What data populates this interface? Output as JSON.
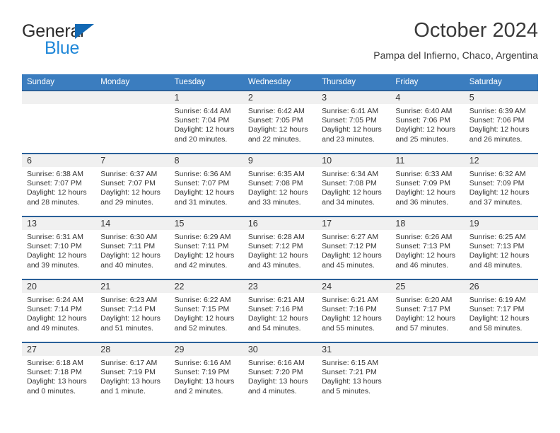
{
  "brand": {
    "line1": "General",
    "line2": "Blue",
    "triangle_color": "#1268b3",
    "blue_text_color": "#1f87d8"
  },
  "header": {
    "title": "October 2024",
    "subtitle": "Pampa del Infierno, Chaco, Argentina"
  },
  "theme": {
    "header_bg": "#3b7dbf",
    "row_border": "#2a6099",
    "daynum_bg": "#f0f0f0"
  },
  "weekday_headers": [
    "Sunday",
    "Monday",
    "Tuesday",
    "Wednesday",
    "Thursday",
    "Friday",
    "Saturday"
  ],
  "labels": {
    "sunrise_prefix": "Sunrise:",
    "sunset_prefix": "Sunset:",
    "daylight_prefix": "Daylight:"
  },
  "weeks": [
    [
      {
        "day": "",
        "sunrise": "",
        "sunset": "",
        "daylight_line1": "",
        "daylight_line2": ""
      },
      {
        "day": "",
        "sunrise": "",
        "sunset": "",
        "daylight_line1": "",
        "daylight_line2": ""
      },
      {
        "day": "1",
        "sunrise": "Sunrise: 6:44 AM",
        "sunset": "Sunset: 7:04 PM",
        "daylight_line1": "Daylight: 12 hours",
        "daylight_line2": "and 20 minutes."
      },
      {
        "day": "2",
        "sunrise": "Sunrise: 6:42 AM",
        "sunset": "Sunset: 7:05 PM",
        "daylight_line1": "Daylight: 12 hours",
        "daylight_line2": "and 22 minutes."
      },
      {
        "day": "3",
        "sunrise": "Sunrise: 6:41 AM",
        "sunset": "Sunset: 7:05 PM",
        "daylight_line1": "Daylight: 12 hours",
        "daylight_line2": "and 23 minutes."
      },
      {
        "day": "4",
        "sunrise": "Sunrise: 6:40 AM",
        "sunset": "Sunset: 7:06 PM",
        "daylight_line1": "Daylight: 12 hours",
        "daylight_line2": "and 25 minutes."
      },
      {
        "day": "5",
        "sunrise": "Sunrise: 6:39 AM",
        "sunset": "Sunset: 7:06 PM",
        "daylight_line1": "Daylight: 12 hours",
        "daylight_line2": "and 26 minutes."
      }
    ],
    [
      {
        "day": "6",
        "sunrise": "Sunrise: 6:38 AM",
        "sunset": "Sunset: 7:07 PM",
        "daylight_line1": "Daylight: 12 hours",
        "daylight_line2": "and 28 minutes."
      },
      {
        "day": "7",
        "sunrise": "Sunrise: 6:37 AM",
        "sunset": "Sunset: 7:07 PM",
        "daylight_line1": "Daylight: 12 hours",
        "daylight_line2": "and 29 minutes."
      },
      {
        "day": "8",
        "sunrise": "Sunrise: 6:36 AM",
        "sunset": "Sunset: 7:07 PM",
        "daylight_line1": "Daylight: 12 hours",
        "daylight_line2": "and 31 minutes."
      },
      {
        "day": "9",
        "sunrise": "Sunrise: 6:35 AM",
        "sunset": "Sunset: 7:08 PM",
        "daylight_line1": "Daylight: 12 hours",
        "daylight_line2": "and 33 minutes."
      },
      {
        "day": "10",
        "sunrise": "Sunrise: 6:34 AM",
        "sunset": "Sunset: 7:08 PM",
        "daylight_line1": "Daylight: 12 hours",
        "daylight_line2": "and 34 minutes."
      },
      {
        "day": "11",
        "sunrise": "Sunrise: 6:33 AM",
        "sunset": "Sunset: 7:09 PM",
        "daylight_line1": "Daylight: 12 hours",
        "daylight_line2": "and 36 minutes."
      },
      {
        "day": "12",
        "sunrise": "Sunrise: 6:32 AM",
        "sunset": "Sunset: 7:09 PM",
        "daylight_line1": "Daylight: 12 hours",
        "daylight_line2": "and 37 minutes."
      }
    ],
    [
      {
        "day": "13",
        "sunrise": "Sunrise: 6:31 AM",
        "sunset": "Sunset: 7:10 PM",
        "daylight_line1": "Daylight: 12 hours",
        "daylight_line2": "and 39 minutes."
      },
      {
        "day": "14",
        "sunrise": "Sunrise: 6:30 AM",
        "sunset": "Sunset: 7:11 PM",
        "daylight_line1": "Daylight: 12 hours",
        "daylight_line2": "and 40 minutes."
      },
      {
        "day": "15",
        "sunrise": "Sunrise: 6:29 AM",
        "sunset": "Sunset: 7:11 PM",
        "daylight_line1": "Daylight: 12 hours",
        "daylight_line2": "and 42 minutes."
      },
      {
        "day": "16",
        "sunrise": "Sunrise: 6:28 AM",
        "sunset": "Sunset: 7:12 PM",
        "daylight_line1": "Daylight: 12 hours",
        "daylight_line2": "and 43 minutes."
      },
      {
        "day": "17",
        "sunrise": "Sunrise: 6:27 AM",
        "sunset": "Sunset: 7:12 PM",
        "daylight_line1": "Daylight: 12 hours",
        "daylight_line2": "and 45 minutes."
      },
      {
        "day": "18",
        "sunrise": "Sunrise: 6:26 AM",
        "sunset": "Sunset: 7:13 PM",
        "daylight_line1": "Daylight: 12 hours",
        "daylight_line2": "and 46 minutes."
      },
      {
        "day": "19",
        "sunrise": "Sunrise: 6:25 AM",
        "sunset": "Sunset: 7:13 PM",
        "daylight_line1": "Daylight: 12 hours",
        "daylight_line2": "and 48 minutes."
      }
    ],
    [
      {
        "day": "20",
        "sunrise": "Sunrise: 6:24 AM",
        "sunset": "Sunset: 7:14 PM",
        "daylight_line1": "Daylight: 12 hours",
        "daylight_line2": "and 49 minutes."
      },
      {
        "day": "21",
        "sunrise": "Sunrise: 6:23 AM",
        "sunset": "Sunset: 7:14 PM",
        "daylight_line1": "Daylight: 12 hours",
        "daylight_line2": "and 51 minutes."
      },
      {
        "day": "22",
        "sunrise": "Sunrise: 6:22 AM",
        "sunset": "Sunset: 7:15 PM",
        "daylight_line1": "Daylight: 12 hours",
        "daylight_line2": "and 52 minutes."
      },
      {
        "day": "23",
        "sunrise": "Sunrise: 6:21 AM",
        "sunset": "Sunset: 7:16 PM",
        "daylight_line1": "Daylight: 12 hours",
        "daylight_line2": "and 54 minutes."
      },
      {
        "day": "24",
        "sunrise": "Sunrise: 6:21 AM",
        "sunset": "Sunset: 7:16 PM",
        "daylight_line1": "Daylight: 12 hours",
        "daylight_line2": "and 55 minutes."
      },
      {
        "day": "25",
        "sunrise": "Sunrise: 6:20 AM",
        "sunset": "Sunset: 7:17 PM",
        "daylight_line1": "Daylight: 12 hours",
        "daylight_line2": "and 57 minutes."
      },
      {
        "day": "26",
        "sunrise": "Sunrise: 6:19 AM",
        "sunset": "Sunset: 7:17 PM",
        "daylight_line1": "Daylight: 12 hours",
        "daylight_line2": "and 58 minutes."
      }
    ],
    [
      {
        "day": "27",
        "sunrise": "Sunrise: 6:18 AM",
        "sunset": "Sunset: 7:18 PM",
        "daylight_line1": "Daylight: 13 hours",
        "daylight_line2": "and 0 minutes."
      },
      {
        "day": "28",
        "sunrise": "Sunrise: 6:17 AM",
        "sunset": "Sunset: 7:19 PM",
        "daylight_line1": "Daylight: 13 hours",
        "daylight_line2": "and 1 minute."
      },
      {
        "day": "29",
        "sunrise": "Sunrise: 6:16 AM",
        "sunset": "Sunset: 7:19 PM",
        "daylight_line1": "Daylight: 13 hours",
        "daylight_line2": "and 2 minutes."
      },
      {
        "day": "30",
        "sunrise": "Sunrise: 6:16 AM",
        "sunset": "Sunset: 7:20 PM",
        "daylight_line1": "Daylight: 13 hours",
        "daylight_line2": "and 4 minutes."
      },
      {
        "day": "31",
        "sunrise": "Sunrise: 6:15 AM",
        "sunset": "Sunset: 7:21 PM",
        "daylight_line1": "Daylight: 13 hours",
        "daylight_line2": "and 5 minutes."
      },
      {
        "day": "",
        "sunrise": "",
        "sunset": "",
        "daylight_line1": "",
        "daylight_line2": ""
      },
      {
        "day": "",
        "sunrise": "",
        "sunset": "",
        "daylight_line1": "",
        "daylight_line2": ""
      }
    ]
  ]
}
